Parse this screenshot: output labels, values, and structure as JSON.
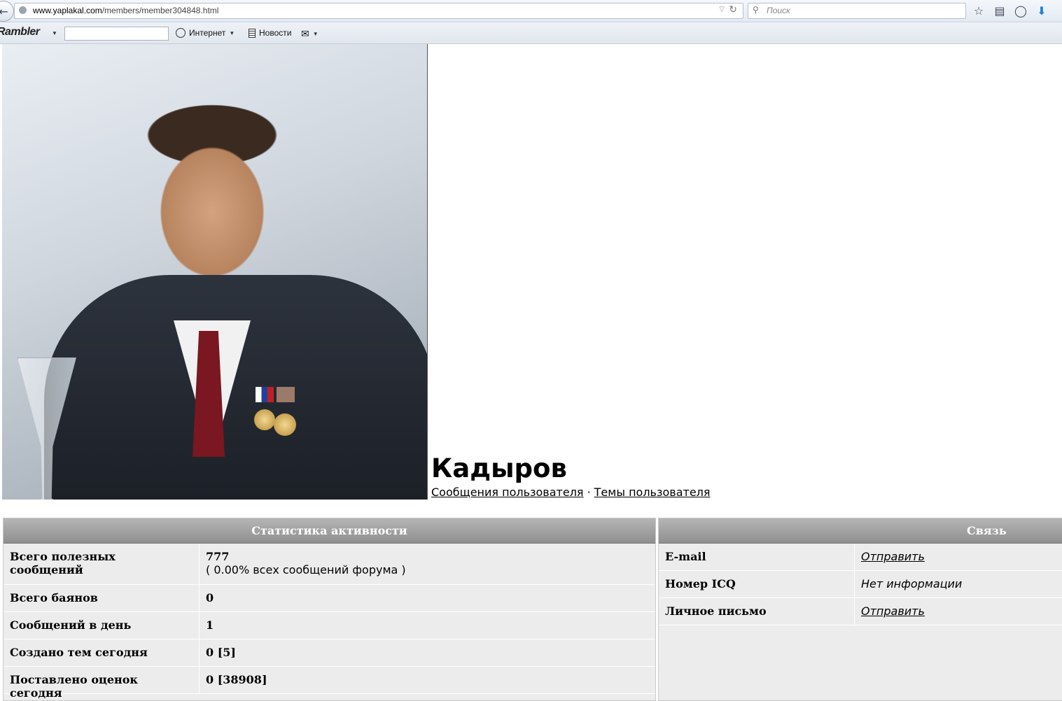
{
  "browser": {
    "url_host": "www.yaplakal.com",
    "url_path": "/members/member304848.html",
    "search_placeholder": "Поиск"
  },
  "rambler_bar": {
    "logo": "Rambler",
    "internet_label": "Интернет",
    "news_label": "Новости"
  },
  "profile": {
    "name": "Кадыров",
    "posts_link": "Сообщения пользователя",
    "separator": "·",
    "topics_link": "Темы пользователя"
  },
  "activity": {
    "title": "Статистика активности",
    "rows": [
      {
        "label": "Всего полезных сообщений",
        "value": "777",
        "sub": "( 0.00% всех сообщений форума )"
      },
      {
        "label": "Всего баянов",
        "value": "0"
      },
      {
        "label": "Сообщений в день",
        "value": "1"
      },
      {
        "label": "Создано тем сегодня",
        "value": "0 [5]"
      },
      {
        "label": "Поставлено оценок сегодня",
        "value": "0 [38908]"
      }
    ]
  },
  "contact": {
    "title": "Связь",
    "rows": [
      {
        "label": "E-mail",
        "value": "Отправить",
        "is_link": true
      },
      {
        "label": "Номер ICQ",
        "value": "Нет информации",
        "is_link": false
      },
      {
        "label": "Личное письмо",
        "value": "Отправить",
        "is_link": true
      }
    ]
  }
}
